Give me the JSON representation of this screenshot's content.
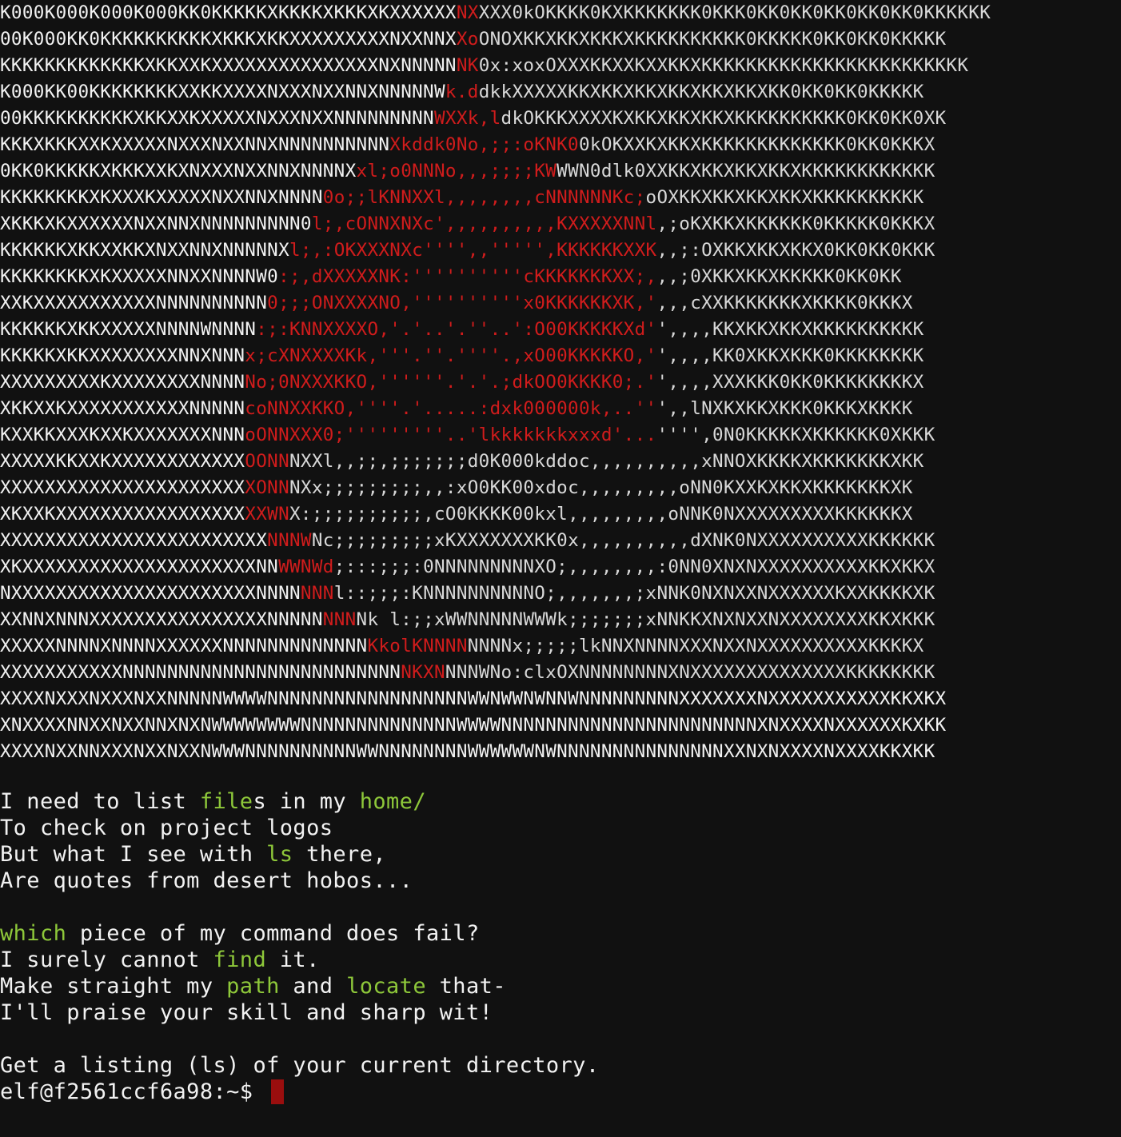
{
  "window": {
    "title": "",
    "background": "#111111"
  },
  "colors": {
    "foreground": "#f2f2f2",
    "dim": "#d8d8d8",
    "red": "#d01c1c",
    "yellow": "#d8b400",
    "highlight": "#8ec83a",
    "cursor": "#9a0e0e"
  },
  "ascii_art": {
    "lines": [
      "K000K000K000K000KK0KKKKKXKKKKXKKKXKXXXXXXNXXXX0kOKKKK0KXKKKKKKK0KKK0KK0KK0KK0KK0KK0KKKKKK",
      "00K000KK0KKKKKKKKKKXKKKXKKXXXXXXXXXNXXNNXXoONOXKKXKKXKKKXKKKKKKKKKK0KKKKK0KK0KK0KKKKK",
      "KKKKKKKKKKKKKXKKXXKXXXXXXXXXXXXXXXNXNNNNNNK0x:xoxOXXXKKXXKXXKKXKKKKKKKKKKKKKKKKKKKKKKKK",
      "K000KK00KKKKKKKKXXKKXXXXNXXXNXXNNXNNNNNWk.ddkkXXXXXKKXKKXKKXKKXKKXKKXKK0KK0KK0KKKKK",
      "00KKKKKKKKKKXKKXXKXXXXXNXXXNXXNNNNNNNNNWXXk,ldkOKKKXXXXKXKKXKKXKKXKKKKKKKKKK0KK0KK0XK",
      "KKKXKKKXXKXXXXXNXXXNXXNNXNNNNNNNNNNXkddk0No,;;:oKNK00kOKXXKXKKXKKKKKKKKKKKKK0KK0KKKX",
      "0KK0KKKKKXKKKXXKXNXXXNXXNNXNNNNXxl;o0NNNo,,,;;;;KWWWN0dlk0XXKKXKKXKKXKKXKKKKKKKKKKKK",
      "KKKKKKKKXKXXXKXXXXXNXXNNXNNNN0o;;lKNNXXl,,,,,,,,cNNNNNNKc;oOXKKXKKXKKXKKXKKKKKKKKKK",
      "XKKKXKXXXXXXNXXNNXNNNNNNNNN0l;,cONNXNXc',,,,,,,,,,KXXXXXNNl,;oKXKKXKKKKKK0KKKKK0KKKX",
      "KKKKKKXKKXXKKXNXXNNXNNNNNXl;,:OKXXXNXc'''',,''''',KKKKKKXXK,,;:OXKKXKKXKKX0KK0KK0KKK",
      "KKKKKKKKXKXXXXXNNXXNNNNW0:;,dXXXXXNK:''''''''''cKKKKKKKXX;,,,;0XKKXKKXKKKKK0KK0KK",
      "XXKXXXXXXXXXXXNNNNNNNNNN0;;;ONXXXXNO,''''''''''x0KKKKKKXK,',,,cXXKKKKKKKXKKKK0KKKX",
      "KKKKKKXKKXXXXXNNNNWNNNN:;:KNNXXXXO,'.'..'.''..':O00KKKKKXd'',,,,KKXKKXKKXKKKKKKKKKK",
      "KKKKKXKKXXXXXXXXNNXNNNx;cXNXXXXKk,'''.''.''''.,xO00KKKKKO,'',,,,KK0XKKXKKK0KKKKKKKK",
      "XXXXXXXXXKXXXXXXXXNNNNNo;0NXXXKKO,''''''.'.'.;dkOO0KKKK0;.'',,,,XXXKKK0KK0KKKKKKKKX",
      "XKKXXKXXXXXXXXXXXNNNNNcoNNXXKKO,''''.'.....:dxk000000k,..''',,lNXKXKKXKKK0KKKXKKKK",
      "KXXKKXXXKXXKXXXXXXXNNNoONNXXX0;'''''''''..'lkkkkkkkxxxd'...'''',0N0KKKKKXKKKKKK0XKKK",
      "XXXXXKKXXKXXXXXXXXXXXXOONNNXXl,,;;,;;;;;;;d0K000kddoc,,,,,,,,,,xNNOXKKKKXKKKKKKKXKK",
      "XXXXXXXXXXXXXXXXXXXXXXXONNNXx;;;;;;;;;,,:xO0KK00xdoc,,,,,,,,,oNN0KXXKXKKXKKKKKKKXK",
      "XKXXKXXXXXXXXXXXXXXXXXXXWNX:;;;;;;;;;;,cO0KKKK00kxl,,,,,,,,,oNNK0NXXXXXXXXXKKKKKKX",
      "XXXXXXXXXXXXXXXXXXXXXXXXNNNWNc;;;;;;;;;xKXXXXXXXKK0x,,,,,,,,,,dXNK0NXXXXXXXXXXKKKKKK",
      "XKXXXXXXXXXXXXXXXXXXXXXNNWWNWd;:::;;;:0NNNNNNNNNXO;,,,,,,,,:0NN0XNXNXXXXXXXXXXKKXKKX",
      "NXXXXXXXXXXXXXXXXXXXXXXNNNNNNNl::;;;:KNNNNNNNNNNO;,,,,,,,;xNNK0NXNXXNXXXXXXKXXKKKKXK",
      "XXNNXNNNXXXXXXXXXXXXXXXXNNNNNNNNNk l:;;xWWNNNNNWWWk;;;;;;;xNNKKXNXNXXNXXXXXXXXKKXKKK",
      "XXXXXNNNNXNNNNXXXXXXNNNNNNNNNNNNNKkolKNNNNNNNNx;;;;;lkNNXNNNNXXXNXXNXXXXXXXXXXKKKKX",
      "XXXXXXXXXXXNNNNNNNNNNNNNNNNNNNNNNNNNNKXNNNNWNo:clxOXNNNNNNNNXNXXXXXXXXXXXXXXKKKKKKKK",
      "XXXXNXXXNXXXNXXNNNNNWWWWNNNNNNNNNNNNNNNNNNWWNWWNWNNWNNNNNNNNNXXXXXXXNXXXXXXXXXXXKKXKX",
      "XNXXXXNNXXNXXNNXNXNWWWWWWWWNNNNNNNNNNNNNNWWWWNNNNNNNNNNNNNNNNNNNNNNNXNXXXXNXXXXXXKXKK",
      "XXXXNXXNNXXXNXXNXXNWWWNNNNNNNNNNWWNNNNNNNNWWWWWWNWNNNNNNNNNNNNNNNXXNXNXXXXNXXXXKKXKK"
    ]
  },
  "poem": {
    "stanza1": {
      "l1_a": "I need to list ",
      "l1_b": "file",
      "l1_c": "s in my ",
      "l1_d": "home/",
      "l2": "To check on project logos",
      "l3_a": "But what I see with ",
      "l3_b": "ls",
      "l3_c": " there,",
      "l4": "Are quotes from desert hobos..."
    },
    "stanza2": {
      "l1_a": "which",
      "l1_b": " piece of my command does fail?",
      "l2_a": "I surely cannot ",
      "l2_b": "find",
      "l2_c": " it.",
      "l3_a": "Make straight my ",
      "l3_b": "path",
      "l3_c": " and ",
      "l3_d": "locate",
      "l3_e": " that-",
      "l4": "I'll praise your skill and sharp wit!"
    }
  },
  "instruction": "Get a listing (ls) of your current directory.",
  "prompt": {
    "text": "elf@f2561ccf6a98:~$ "
  }
}
